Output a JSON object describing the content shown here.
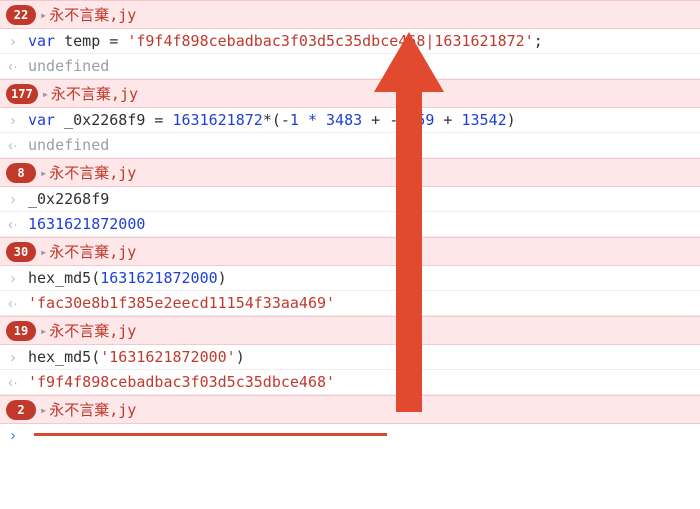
{
  "banners": {
    "b1": {
      "count": "22",
      "text": "永不言棄,jy"
    },
    "b2": {
      "count": "177",
      "text": "永不言棄,jy"
    },
    "b3": {
      "count": "8",
      "text": "永不言棄,jy"
    },
    "b4": {
      "count": "30",
      "text": "永不言棄,jy"
    },
    "b5": {
      "count": "19",
      "text": "永不言棄,jy"
    },
    "b6": {
      "count": "2",
      "text": "永不言棄,jy"
    }
  },
  "code": {
    "c1": {
      "kw": "var",
      "name": "temp",
      "eq": " = ",
      "str": "'f9f4f898cebadbac3f03d5c35dbce468|1631621872'",
      "semi": ";"
    },
    "undef": "undefined",
    "c2": {
      "kw": "var",
      "name": "_0x2268f9",
      "eq": " = ",
      "n1": "1631621872",
      "mul": "*(-",
      "n2": "1 * 3483",
      "plus": " + -",
      "n3": "9059",
      "plus2": " + ",
      "n4": "13542",
      "close": ")"
    },
    "c3": {
      "name": "_0x2268f9"
    },
    "c3out": "1631621872000",
    "c4": {
      "fn": "hex_md5(",
      "arg": "1631621872000",
      "close": ")"
    },
    "c4out": "'fac30e8b1f385e2eecd11154f33aa469'",
    "c5": {
      "fn": "hex_md5(",
      "arg": "'1631621872000'",
      "close": ")"
    },
    "c5out": "'f9f4f898cebadbac3f03d5c35dbce468'"
  },
  "glyphs": {
    "in": "›",
    "out": "‹·",
    "disclo": "▸",
    "prompt": "›"
  }
}
